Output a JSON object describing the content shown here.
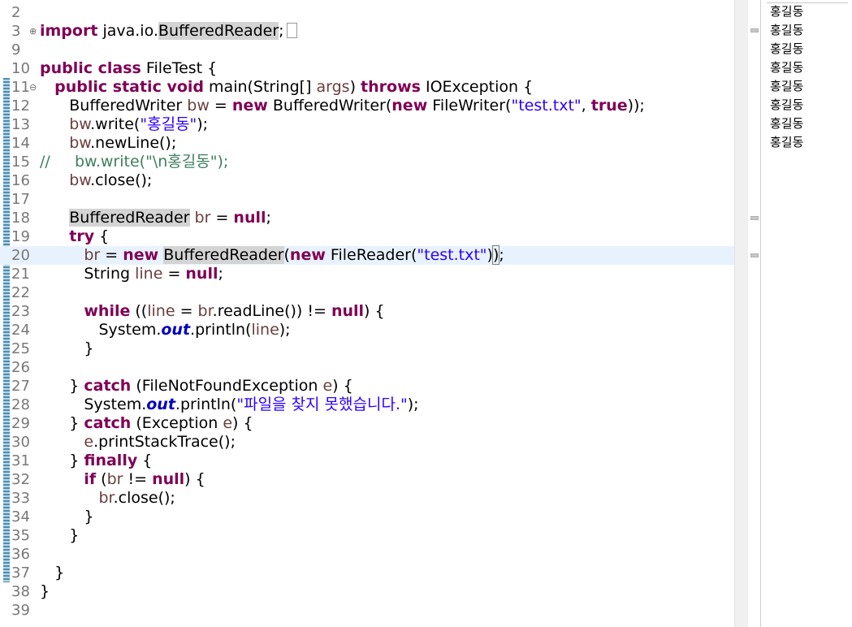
{
  "editor": {
    "current_line": "20",
    "lines": [
      {
        "num": "2",
        "fold": "",
        "tokens": []
      },
      {
        "num": "3",
        "fold": "⊕",
        "tokens": [
          {
            "t": "import",
            "c": "kw"
          },
          {
            "t": " java.io.",
            "c": ""
          },
          {
            "t": "BufferedReader",
            "c": "hl"
          },
          {
            "t": ";",
            "c": ""
          },
          {
            "t": "▯",
            "c": "box"
          }
        ]
      },
      {
        "num": "9",
        "fold": "",
        "tokens": []
      },
      {
        "num": "10",
        "fold": "",
        "tokens": [
          {
            "t": "public class",
            "c": "kw"
          },
          {
            "t": " FileTest {",
            "c": ""
          }
        ]
      },
      {
        "num": "11",
        "fold": "⊖",
        "tokens": [
          {
            "t": "   ",
            "c": ""
          },
          {
            "t": "public static void",
            "c": "kw"
          },
          {
            "t": " main(String[] ",
            "c": ""
          },
          {
            "t": "args",
            "c": "var"
          },
          {
            "t": ") ",
            "c": ""
          },
          {
            "t": "throws",
            "c": "kw"
          },
          {
            "t": " IOException {",
            "c": ""
          }
        ]
      },
      {
        "num": "12",
        "fold": "",
        "tokens": [
          {
            "t": "      BufferedWriter ",
            "c": ""
          },
          {
            "t": "bw",
            "c": "var"
          },
          {
            "t": " = ",
            "c": ""
          },
          {
            "t": "new",
            "c": "kw"
          },
          {
            "t": " BufferedWriter(",
            "c": ""
          },
          {
            "t": "new",
            "c": "kw"
          },
          {
            "t": " FileWriter(",
            "c": ""
          },
          {
            "t": "\"test.txt\"",
            "c": "str"
          },
          {
            "t": ", ",
            "c": ""
          },
          {
            "t": "true",
            "c": "kw"
          },
          {
            "t": "));",
            "c": ""
          }
        ]
      },
      {
        "num": "13",
        "fold": "",
        "tokens": [
          {
            "t": "      ",
            "c": ""
          },
          {
            "t": "bw",
            "c": "var"
          },
          {
            "t": ".write(",
            "c": ""
          },
          {
            "t": "\"홍길동\"",
            "c": "str"
          },
          {
            "t": ");",
            "c": ""
          }
        ]
      },
      {
        "num": "14",
        "fold": "",
        "tokens": [
          {
            "t": "      ",
            "c": ""
          },
          {
            "t": "bw",
            "c": "var"
          },
          {
            "t": ".newLine();",
            "c": ""
          }
        ]
      },
      {
        "num": "15",
        "fold": "",
        "tokens": [
          {
            "t": "//     bw.write(\"\\n홍길동\");",
            "c": "cmt"
          }
        ]
      },
      {
        "num": "16",
        "fold": "",
        "tokens": [
          {
            "t": "      ",
            "c": ""
          },
          {
            "t": "bw",
            "c": "var"
          },
          {
            "t": ".close();",
            "c": ""
          }
        ]
      },
      {
        "num": "17",
        "fold": "",
        "tokens": []
      },
      {
        "num": "18",
        "fold": "",
        "tokens": [
          {
            "t": "      ",
            "c": ""
          },
          {
            "t": "BufferedReader",
            "c": "hl"
          },
          {
            "t": " ",
            "c": ""
          },
          {
            "t": "br",
            "c": "var"
          },
          {
            "t": " = ",
            "c": ""
          },
          {
            "t": "null",
            "c": "kw"
          },
          {
            "t": ";",
            "c": ""
          }
        ]
      },
      {
        "num": "19",
        "fold": "",
        "tokens": [
          {
            "t": "      ",
            "c": ""
          },
          {
            "t": "try",
            "c": "kw"
          },
          {
            "t": " {",
            "c": ""
          }
        ]
      },
      {
        "num": "20",
        "fold": "",
        "tokens": [
          {
            "t": "         ",
            "c": ""
          },
          {
            "t": "br",
            "c": "var"
          },
          {
            "t": " = ",
            "c": ""
          },
          {
            "t": "new",
            "c": "kw"
          },
          {
            "t": " ",
            "c": ""
          },
          {
            "t": "BufferedReader",
            "c": "hl"
          },
          {
            "t": "(",
            "c": ""
          },
          {
            "t": "new",
            "c": "kw"
          },
          {
            "t": " FileReader(",
            "c": ""
          },
          {
            "t": "\"test.txt\"",
            "c": "str"
          },
          {
            "t": ")",
            "c": ""
          },
          {
            "t": ")",
            "c": "bracket"
          },
          {
            "t": ";",
            "c": ""
          }
        ]
      },
      {
        "num": "21",
        "fold": "",
        "tokens": [
          {
            "t": "         String ",
            "c": ""
          },
          {
            "t": "line",
            "c": "var"
          },
          {
            "t": " = ",
            "c": ""
          },
          {
            "t": "null",
            "c": "kw"
          },
          {
            "t": ";",
            "c": ""
          }
        ]
      },
      {
        "num": "22",
        "fold": "",
        "tokens": []
      },
      {
        "num": "23",
        "fold": "",
        "tokens": [
          {
            "t": "         ",
            "c": ""
          },
          {
            "t": "while",
            "c": "kw"
          },
          {
            "t": " ((",
            "c": ""
          },
          {
            "t": "line",
            "c": "var"
          },
          {
            "t": " = ",
            "c": ""
          },
          {
            "t": "br",
            "c": "var"
          },
          {
            "t": ".readLine()) != ",
            "c": ""
          },
          {
            "t": "null",
            "c": "kw"
          },
          {
            "t": ") {",
            "c": ""
          }
        ]
      },
      {
        "num": "24",
        "fold": "",
        "tokens": [
          {
            "t": "            System.",
            "c": ""
          },
          {
            "t": "out",
            "c": "fld"
          },
          {
            "t": ".println(",
            "c": ""
          },
          {
            "t": "line",
            "c": "var"
          },
          {
            "t": ");",
            "c": ""
          }
        ]
      },
      {
        "num": "25",
        "fold": "",
        "tokens": [
          {
            "t": "         }",
            "c": ""
          }
        ]
      },
      {
        "num": "26",
        "fold": "",
        "tokens": []
      },
      {
        "num": "27",
        "fold": "",
        "tokens": [
          {
            "t": "      } ",
            "c": ""
          },
          {
            "t": "catch",
            "c": "kw"
          },
          {
            "t": " (FileNotFoundException ",
            "c": ""
          },
          {
            "t": "e",
            "c": "var"
          },
          {
            "t": ") {",
            "c": ""
          }
        ]
      },
      {
        "num": "28",
        "fold": "",
        "tokens": [
          {
            "t": "         System.",
            "c": ""
          },
          {
            "t": "out",
            "c": "fld"
          },
          {
            "t": ".println(",
            "c": ""
          },
          {
            "t": "\"파일을 찾지 못했습니다.\"",
            "c": "str"
          },
          {
            "t": ");",
            "c": ""
          }
        ]
      },
      {
        "num": "29",
        "fold": "",
        "tokens": [
          {
            "t": "      } ",
            "c": ""
          },
          {
            "t": "catch",
            "c": "kw"
          },
          {
            "t": " (Exception ",
            "c": ""
          },
          {
            "t": "e",
            "c": "var"
          },
          {
            "t": ") {",
            "c": ""
          }
        ]
      },
      {
        "num": "30",
        "fold": "",
        "tokens": [
          {
            "t": "         ",
            "c": ""
          },
          {
            "t": "e",
            "c": "var"
          },
          {
            "t": ".printStackTrace();",
            "c": ""
          }
        ]
      },
      {
        "num": "31",
        "fold": "",
        "tokens": [
          {
            "t": "      } ",
            "c": ""
          },
          {
            "t": "finally",
            "c": "kw"
          },
          {
            "t": " {",
            "c": ""
          }
        ]
      },
      {
        "num": "32",
        "fold": "",
        "tokens": [
          {
            "t": "         ",
            "c": ""
          },
          {
            "t": "if",
            "c": "kw"
          },
          {
            "t": " (",
            "c": ""
          },
          {
            "t": "br",
            "c": "var"
          },
          {
            "t": " != ",
            "c": ""
          },
          {
            "t": "null",
            "c": "kw"
          },
          {
            "t": ") {",
            "c": ""
          }
        ]
      },
      {
        "num": "33",
        "fold": "",
        "tokens": [
          {
            "t": "            ",
            "c": ""
          },
          {
            "t": "br",
            "c": "var"
          },
          {
            "t": ".close();",
            "c": ""
          }
        ]
      },
      {
        "num": "34",
        "fold": "",
        "tokens": [
          {
            "t": "         }",
            "c": ""
          }
        ]
      },
      {
        "num": "35",
        "fold": "",
        "tokens": [
          {
            "t": "      }",
            "c": ""
          }
        ]
      },
      {
        "num": "36",
        "fold": "",
        "tokens": []
      },
      {
        "num": "37",
        "fold": "",
        "tokens": [
          {
            "t": "   }",
            "c": ""
          }
        ]
      },
      {
        "num": "38",
        "fold": "",
        "tokens": [
          {
            "t": "}",
            "c": ""
          }
        ]
      },
      {
        "num": "39",
        "fold": "",
        "tokens": []
      }
    ]
  },
  "console": {
    "output": [
      "홍길동",
      "홍길동",
      "홍길동",
      "홍길동",
      "홍길동",
      "홍길동",
      "홍길동",
      "홍길동"
    ]
  }
}
